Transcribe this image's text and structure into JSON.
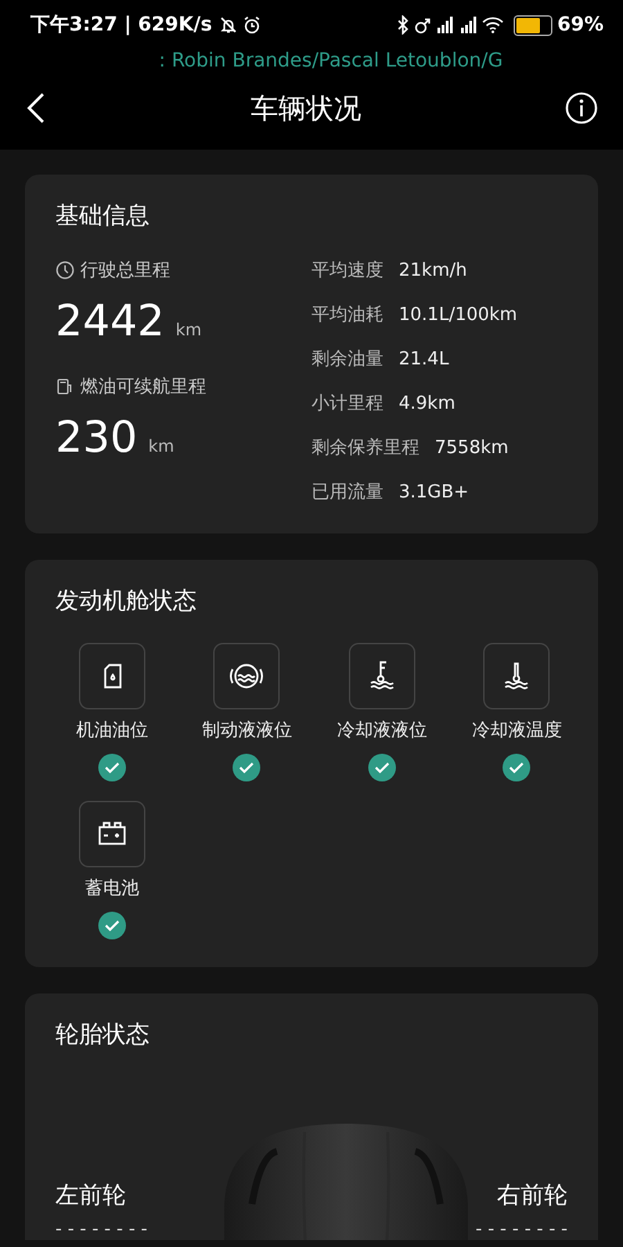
{
  "status_bar": {
    "time": "下午3:27 | 629K/s",
    "battery": "69%",
    "ticker": ": Robin Brandes/Pascal Letoublon/G"
  },
  "header": {
    "title": "车辆状况"
  },
  "basic_info": {
    "title": "基础信息",
    "mileage": [
      {
        "kind": "odometer",
        "label": "行驶总里程",
        "value": "2442",
        "unit": "km"
      },
      {
        "kind": "fuel",
        "label": "燃油可续航里程",
        "value": "230",
        "unit": "km"
      }
    ],
    "stats": [
      {
        "label": "平均速度",
        "value": "21km/h"
      },
      {
        "label": "平均油耗",
        "value": "10.1L/100km"
      },
      {
        "label": "剩余油量",
        "value": "21.4L"
      },
      {
        "label": "小计里程",
        "value": "4.9km"
      },
      {
        "label": "剩余保养里程",
        "value": "7558km"
      },
      {
        "label": "已用流量",
        "value": "3.1GB+"
      }
    ]
  },
  "engine": {
    "title": "发动机舱状态",
    "items": [
      {
        "kind": "oil",
        "label": "机油油位",
        "ok": true
      },
      {
        "kind": "brake",
        "label": "制动液液位",
        "ok": true
      },
      {
        "kind": "coolant_level",
        "label": "冷却液液位",
        "ok": true
      },
      {
        "kind": "coolant_temp",
        "label": "冷却液温度",
        "ok": true
      },
      {
        "kind": "battery",
        "label": "蓄电池",
        "ok": true
      }
    ]
  },
  "tires": {
    "title": "轮胎状态",
    "items": [
      {
        "label": "左前轮",
        "value": "- - - - - - - -"
      },
      {
        "label": "右前轮",
        "value": "- - - - - - - -"
      }
    ]
  }
}
